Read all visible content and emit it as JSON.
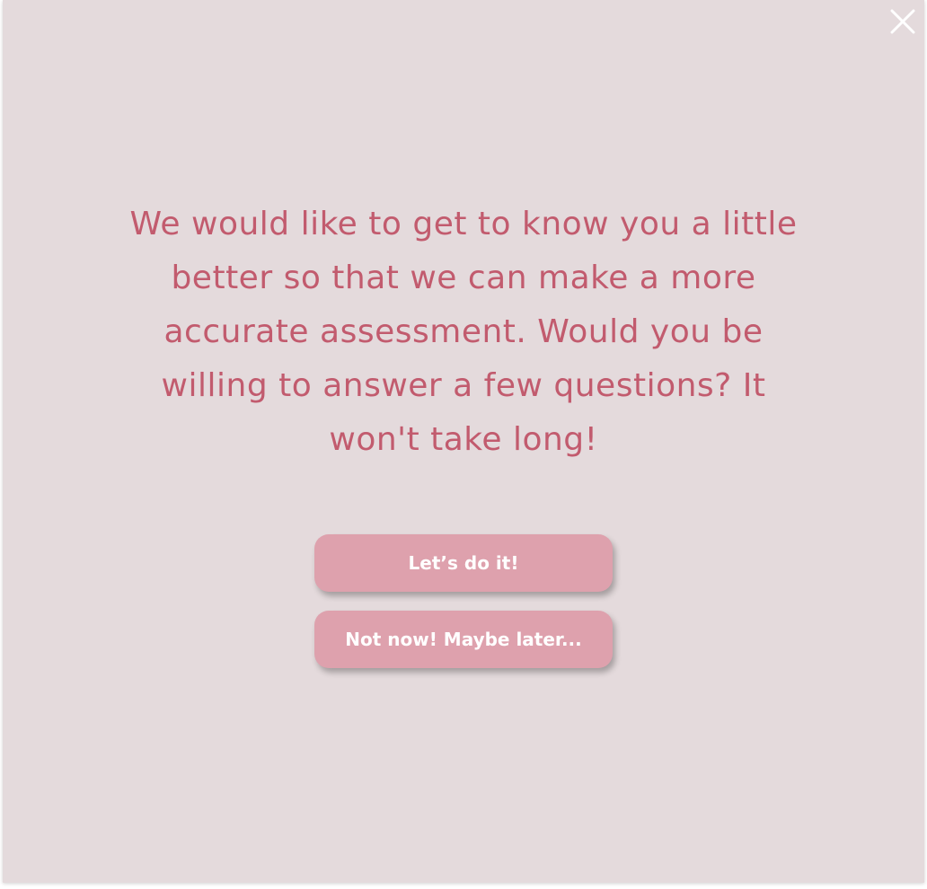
{
  "dialog": {
    "message": "We would like to get to know you a little better so that we can make a more accurate assessment. Would you be willing to answer a few questions? It won't take long!",
    "primary_button": "Let’s do it!",
    "secondary_button": "Not now! Maybe later..."
  },
  "icons": {
    "close": "close-icon"
  },
  "colors": {
    "background": "#e4dadc",
    "message_text": "#c25b6e",
    "button_bg": "#dea1ad",
    "button_text": "#ffffff",
    "close_icon": "#ffffff"
  }
}
